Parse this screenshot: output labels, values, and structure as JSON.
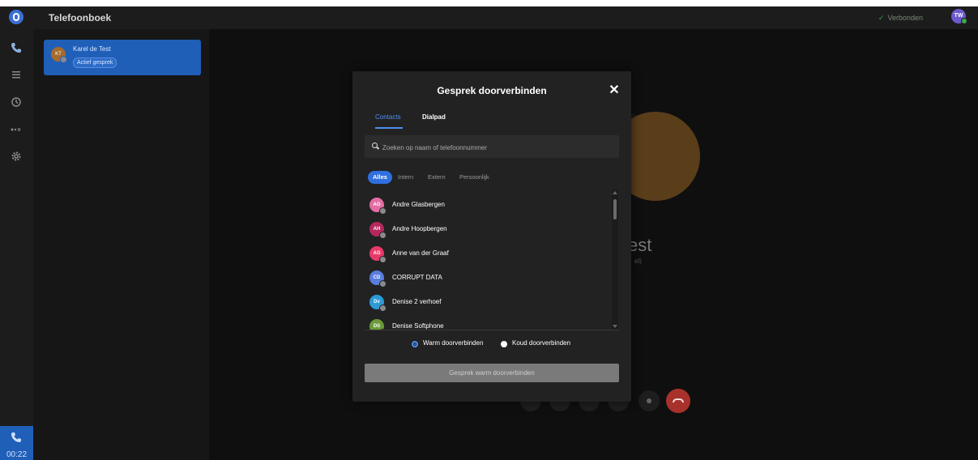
{
  "app": {
    "title": "Telefoonboek",
    "status": "Verbonden",
    "user_initials": "TW"
  },
  "rail": {
    "timer": "00:22"
  },
  "active_call": {
    "initials": "KT",
    "name": "Karel de Test",
    "badge": "Actief gesprek"
  },
  "background": {
    "name_fragment": "est",
    "sub_fragment": "el)"
  },
  "modal": {
    "title": "Gesprek doorverbinden",
    "close": "✕",
    "tabs": [
      {
        "label": "Contacts",
        "active": true
      },
      {
        "label": "Dialpad",
        "active": false
      }
    ],
    "search": {
      "placeholder": "Zoeken op naam of telefoonnummer",
      "value": ""
    },
    "filters": [
      {
        "label": "Alles",
        "active": true
      },
      {
        "label": "Intern",
        "active": false
      },
      {
        "label": "Extern",
        "active": false
      },
      {
        "label": "Persoonlijk",
        "active": false
      }
    ],
    "contacts": [
      {
        "initials": "AG",
        "name": "Andre Glasbergen",
        "color": "#e46ca4"
      },
      {
        "initials": "AH",
        "name": "Andre Hoopbergen",
        "color": "#b5285e"
      },
      {
        "initials": "AG",
        "name": "Anne van der Graaf",
        "color": "#e83a6a"
      },
      {
        "initials": "CD",
        "name": "CORRUPT DATA",
        "color": "#5a7ee0"
      },
      {
        "initials": "Dv",
        "name": "Denise 2 verhoef",
        "color": "#2d9ad8"
      },
      {
        "initials": "DS",
        "name": "Denise Softphone",
        "color": "#6a9a3a"
      }
    ],
    "transfer_options": [
      {
        "label": "Warm doorverbinden",
        "selected": true
      },
      {
        "label": "Koud doorverbinden",
        "selected": false
      }
    ],
    "submit_label": "Gesprek warm doorverbinden"
  },
  "colors": {
    "accent": "#2f6fe0",
    "hangup": "#a8322b",
    "online": "#3aa84a"
  }
}
